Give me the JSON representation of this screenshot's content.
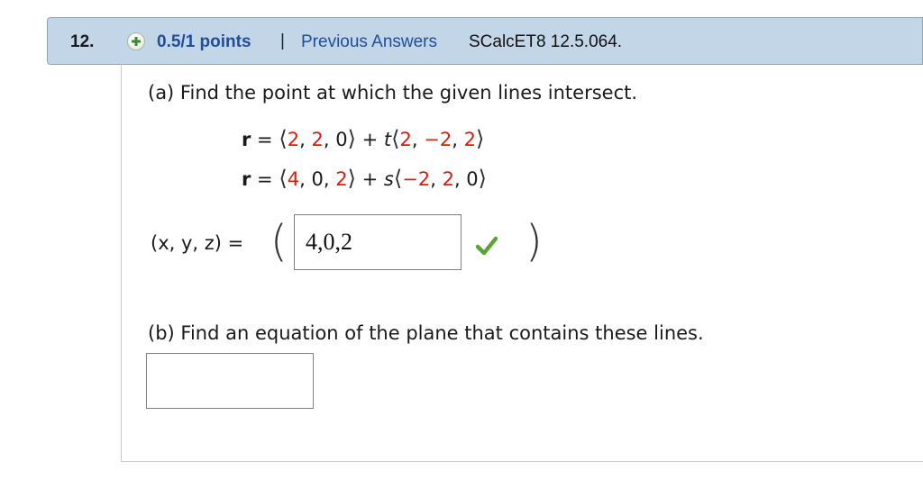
{
  "header": {
    "question_number": "12.",
    "points": "0.5/1 points",
    "separator": "|",
    "previous_answers": "Previous Answers",
    "problem_code": "SCalcET8 12.5.064.",
    "accent_color": "#1f4e9c",
    "background_color": "#c2d6e8"
  },
  "part_a": {
    "prompt": "(a) Find the point at which the given lines intersect.",
    "line1": {
      "lhs": "r",
      "eq": "=",
      "point": [
        "2",
        "2",
        "0"
      ],
      "param": "t",
      "direction": [
        "2",
        "−2",
        "2"
      ]
    },
    "line2": {
      "lhs": "r",
      "eq": "=",
      "point": [
        "4",
        "0",
        "2"
      ],
      "param": "s",
      "direction": [
        "−2",
        "2",
        "0"
      ]
    },
    "answer_label": "(x, y, z) =",
    "answer_value": "4,0,2",
    "answer_status": "correct"
  },
  "part_b": {
    "prompt": "(b) Find an equation of the plane that contains these lines.",
    "answer_value": ""
  },
  "colors": {
    "red_values": "#d21f12",
    "check_green": "#5aa532"
  }
}
